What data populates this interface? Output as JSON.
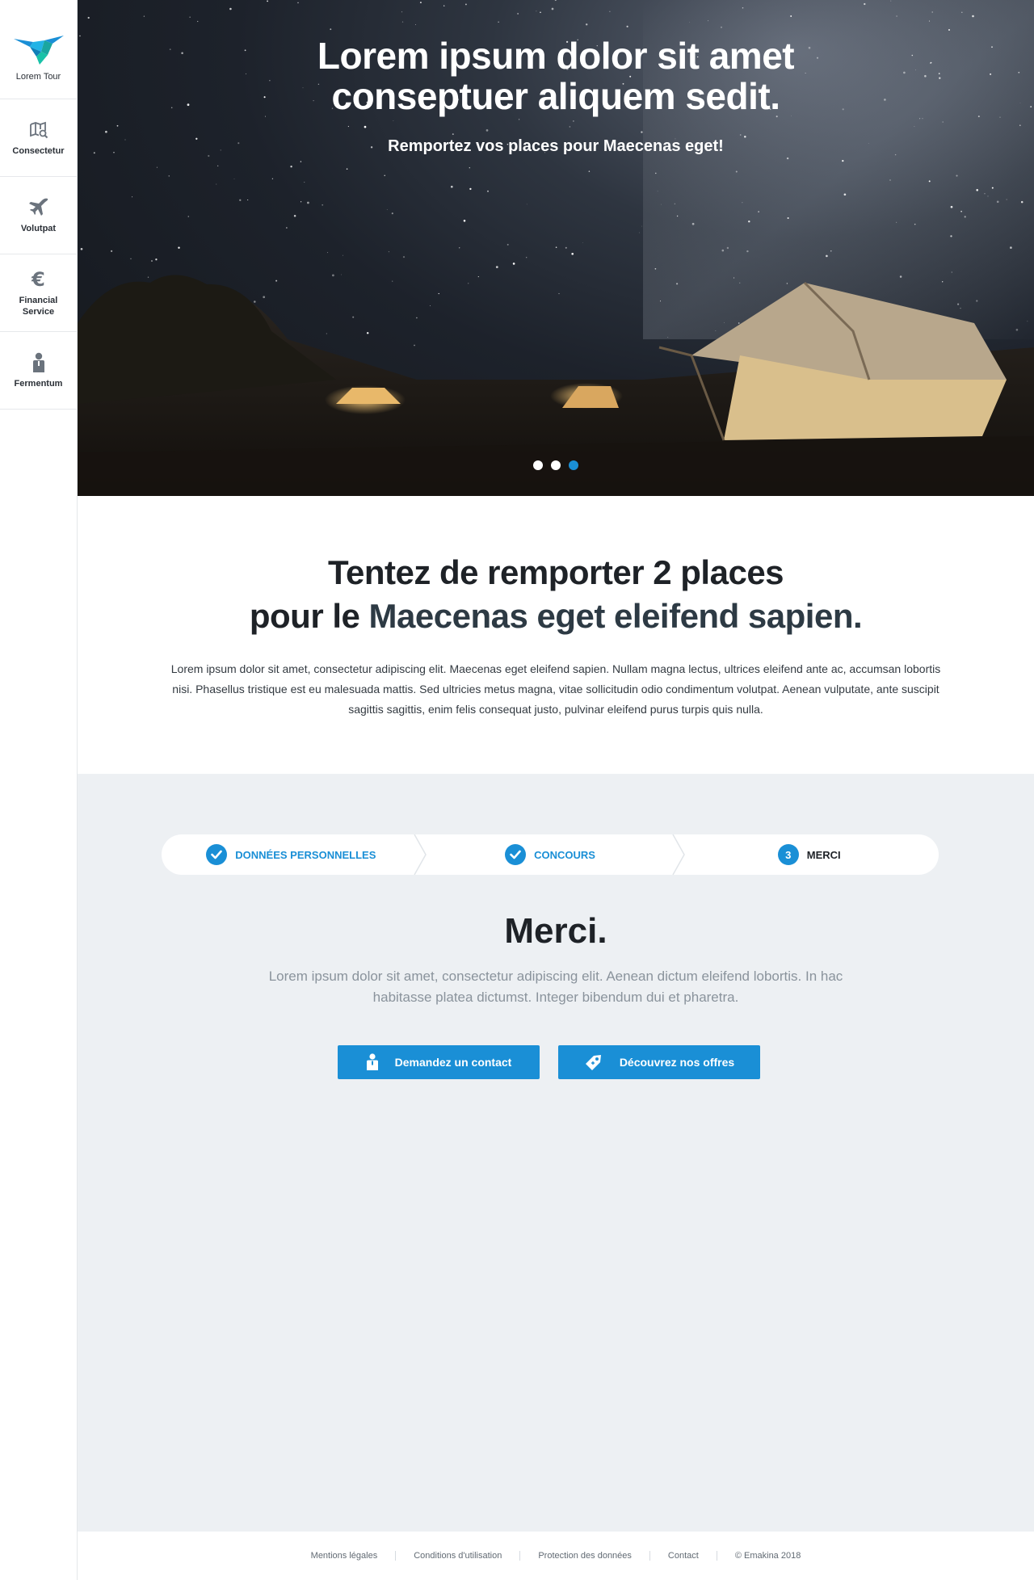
{
  "sidebar": {
    "logo_label": "Lorem Tour",
    "items": [
      {
        "label": "Consectetur",
        "icon": "map-search-icon"
      },
      {
        "label": "Volutpat",
        "icon": "airplane-icon"
      },
      {
        "label": "Financial Service",
        "icon": "euro-icon"
      },
      {
        "label": "Fermentum",
        "icon": "person-icon"
      }
    ]
  },
  "hero": {
    "title_line1": "Lorem ipsum dolor sit amet",
    "title_line2": "conseptuer aliquem sedit.",
    "subtitle": "Remportez vos places pour Maecenas eget!",
    "active_slide": 3,
    "slide_count": 3
  },
  "intro": {
    "heading_line1": "Tentez de remporter 2 places",
    "heading_line2_a": "pour le ",
    "heading_line2_b": "Maecenas eget eleifend sapien.",
    "paragraph": "Lorem ipsum dolor sit amet, consectetur adipiscing elit. Maecenas eget eleifend sapien. Nullam magna lectus, ultrices eleifend ante ac, accumsan lobortis nisi. Phasellus tristique est eu malesuada mattis. Sed ultricies metus magna, vitae sollicitudin odio condimentum volutpat. Aenean vulputate, ante suscipit sagittis sagittis, enim felis consequat justo, pulvinar eleifend purus turpis quis nulla."
  },
  "steps": [
    {
      "label": "DONNÉES PERSONNELLES",
      "state": "done"
    },
    {
      "label": "CONCOURS",
      "state": "done"
    },
    {
      "number": "3",
      "label": "MERCI",
      "state": "current"
    }
  ],
  "merci": {
    "heading": "Merci.",
    "paragraph": "Lorem ipsum dolor sit amet, consectetur adipiscing elit. Aenean dictum eleifend lobortis. In hac habitasse platea dictumst. Integer bibendum dui et pharetra.",
    "button_contact": "Demandez un contact",
    "button_offers": "Découvrez nos offres"
  },
  "footer": {
    "links": [
      "Mentions légales",
      "Conditions d'utilisation",
      "Protection des données",
      "Contact"
    ],
    "copyright": "© Emakina 2018"
  },
  "colors": {
    "accent": "#1a8fd6",
    "grey_bg": "#edf0f3",
    "text_dark": "#1e2227"
  }
}
